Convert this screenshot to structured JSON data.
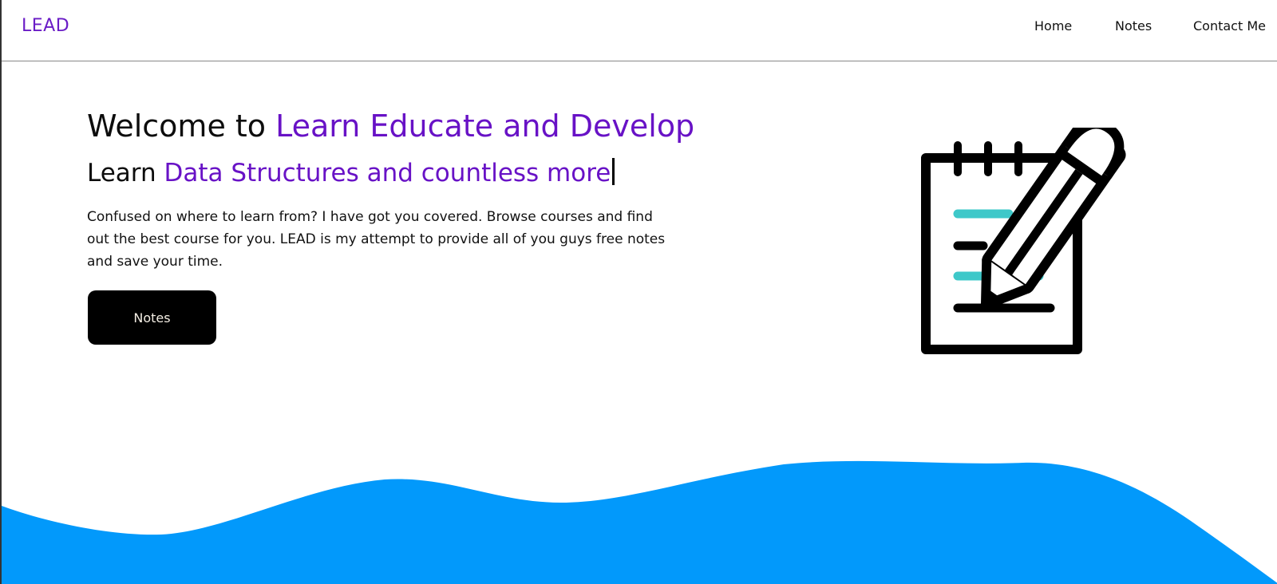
{
  "nav": {
    "logo": "LEAD",
    "links": [
      {
        "label": "Home"
      },
      {
        "label": "Notes"
      },
      {
        "label": "Contact Me"
      }
    ]
  },
  "hero": {
    "title_prefix": "Welcome to ",
    "title_accent": "Learn Educate and Develop",
    "subtitle_prefix": "Learn ",
    "subtitle_accent": "Data Structures and countless more",
    "description": "Confused on where to learn from? I have got you covered. Browse courses and find out the best course for you. LEAD is my attempt to provide all of you guys free notes and save your time.",
    "cta_label": "Notes"
  },
  "colors": {
    "brand_purple": "#6812c6",
    "wave_blue": "#0299fb",
    "illustration_teal": "#3ec8c9"
  },
  "icons": {
    "illustration": "notepad-pencil-icon"
  }
}
